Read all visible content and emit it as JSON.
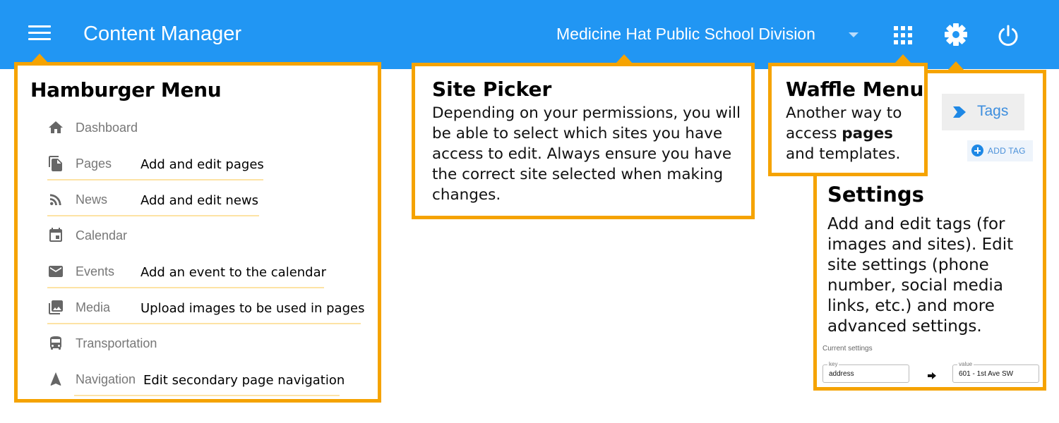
{
  "topbar": {
    "app_title": "Content Manager",
    "site_name": "Medicine Hat Public School Division",
    "icons": [
      "hamburger-icon",
      "chevron-down-icon",
      "apps-grid-icon",
      "gear-icon",
      "power-icon"
    ]
  },
  "colors": {
    "topbar": "#2196f3",
    "callout_border": "#f5a300",
    "note_underline": "#fde3a5",
    "link_blue": "#3d8ede"
  },
  "hamburger_menu": {
    "title": "Hamburger Menu",
    "items": [
      {
        "label": "Dashboard",
        "icon": "home-icon",
        "note": ""
      },
      {
        "label": "Pages",
        "icon": "pages-icon",
        "note": "Add and edit pages"
      },
      {
        "label": "News",
        "icon": "rss-icon",
        "note": "Add and edit news"
      },
      {
        "label": "Calendar",
        "icon": "calendar-icon",
        "note": ""
      },
      {
        "label": "Events",
        "icon": "mail-icon",
        "note": "Add an event to the calendar"
      },
      {
        "label": "Media",
        "icon": "photo-library-icon",
        "note": "Upload images to be used in pages"
      },
      {
        "label": "Transportation",
        "icon": "bus-icon",
        "note": ""
      },
      {
        "label": "Navigation",
        "icon": "navigation-arrow-icon",
        "note": "Edit secondary page navigation"
      }
    ]
  },
  "site_picker": {
    "title": "Site Picker",
    "text": "Depending on your permissions, you will be able to select which sites you have access to edit. Always ensure you have the correct site selected when making changes."
  },
  "waffle_menu": {
    "title": "Waffle Menu",
    "text_before": "Another way to access ",
    "text_bold": "pages",
    "text_after": " and templates."
  },
  "settings": {
    "title": "Settings",
    "text": "Add and edit tags (for images and sites). Edit site settings (phone number, social media links, etc.) and more advanced settings.",
    "tags_label": "Tags",
    "add_tag_label": "ADD TAG",
    "current_settings_label": "Current settings",
    "key_label": "key",
    "key_value": "address",
    "value_label": "value",
    "value_value": "601 - 1st Ave SW"
  }
}
